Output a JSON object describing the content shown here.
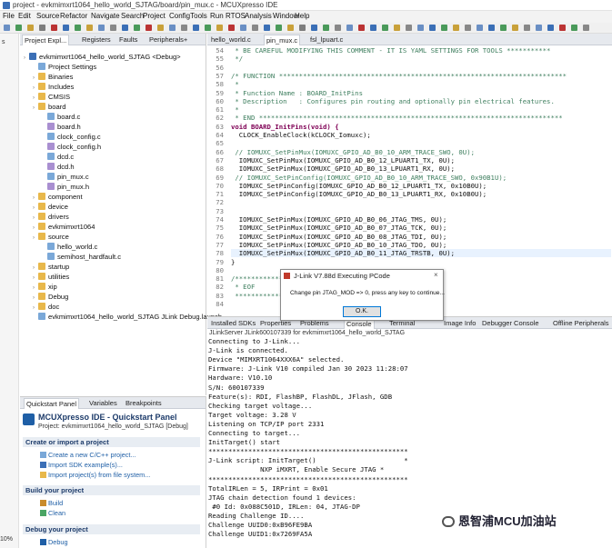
{
  "window": {
    "title": "project - evkmimxrt1064_hello_world_SJTAG/board/pin_mux.c - MCUXpresso IDE"
  },
  "menu": [
    "File",
    "Edit",
    "Source",
    "Refactor",
    "Navigate",
    "Search",
    "Project",
    "ConfigTools",
    "Run",
    "RTOS",
    "Analysis",
    "Window",
    "Help"
  ],
  "leftstrip": {
    "top": "s",
    "bottom": "10%"
  },
  "left_tabs": [
    "Project Expl...",
    "Registers",
    "Faults",
    "Peripherals+"
  ],
  "tree": [
    {
      "label": "evkmimxrt1064_hello_world_SJTAG <Debug>",
      "icon": "project-icon"
    },
    {
      "label": "Project Settings",
      "icon": "settings-icon"
    },
    {
      "label": "Binaries",
      "icon": "folder-icon"
    },
    {
      "label": "Includes",
      "icon": "folder-icon"
    },
    {
      "label": "CMSIS",
      "icon": "folder-icon"
    },
    {
      "label": "board",
      "icon": "folder-icon"
    },
    {
      "label": "board.c",
      "icon": "c-file-icon"
    },
    {
      "label": "board.h",
      "icon": "h-file-icon"
    },
    {
      "label": "clock_config.c",
      "icon": "c-file-icon"
    },
    {
      "label": "clock_config.h",
      "icon": "h-file-icon"
    },
    {
      "label": "dcd.c",
      "icon": "c-file-icon"
    },
    {
      "label": "dcd.h",
      "icon": "h-file-icon"
    },
    {
      "label": "pin_mux.c",
      "icon": "c-file-icon"
    },
    {
      "label": "pin_mux.h",
      "icon": "h-file-icon"
    },
    {
      "label": "component",
      "icon": "folder-icon"
    },
    {
      "label": "device",
      "icon": "folder-icon"
    },
    {
      "label": "drivers",
      "icon": "folder-icon"
    },
    {
      "label": "evkmimxrt1064",
      "icon": "folder-icon"
    },
    {
      "label": "source",
      "icon": "folder-icon"
    },
    {
      "label": "hello_world.c",
      "icon": "c-file-icon"
    },
    {
      "label": "semihost_hardfault.c",
      "icon": "c-file-icon"
    },
    {
      "label": "startup",
      "icon": "folder-icon"
    },
    {
      "label": "utilities",
      "icon": "folder-icon"
    },
    {
      "label": "xip",
      "icon": "folder-icon"
    },
    {
      "label": "Debug",
      "icon": "folder-icon"
    },
    {
      "label": "doc",
      "icon": "folder-icon"
    },
    {
      "label": "evkmimxrt1064_hello_world_SJTAG JLink Debug.launch",
      "icon": "launch-file-icon"
    }
  ],
  "editor_tabs": [
    "hello_world.c",
    "pin_mux.c",
    "fsl_lpuart.c"
  ],
  "code": [
    {
      "n": "54",
      "t": " * BE CAREFUL MODIFYING THIS COMMENT - IT IS YAML SETTINGS FOR TOOLS ***********",
      "c": "cm"
    },
    {
      "n": "55",
      "t": " */",
      "c": "cm"
    },
    {
      "n": "56",
      "t": "",
      "c": ""
    },
    {
      "n": "57",
      "t": "/* FUNCTION ************************************************************************",
      "c": "cm"
    },
    {
      "n": "58",
      "t": " *",
      "c": "cm"
    },
    {
      "n": "59",
      "t": " * Function Name : BOARD_InitPins",
      "c": "cm"
    },
    {
      "n": "60",
      "t": " * Description   : Configures pin routing and optionally pin electrical features.",
      "c": "cm"
    },
    {
      "n": "61",
      "t": " *",
      "c": "cm"
    },
    {
      "n": "62",
      "t": " * END ****************************************************************************",
      "c": "cm"
    },
    {
      "n": "63",
      "t": "void BOARD_InitPins(void) {",
      "c": "fnline"
    },
    {
      "n": "64",
      "t": "  CLOCK_EnableClock(kCLOCK_Iomuxc);",
      "c": "clk"
    },
    {
      "n": "65",
      "t": "",
      "c": ""
    },
    {
      "n": "66",
      "t": " // IOMUXC_SetPinMux(IOMUXC_GPIO_AD_B0_10_ARM_TRACE_SWO, 0U);",
      "c": "cm"
    },
    {
      "n": "67",
      "t": "  IOMUXC_SetPinMux(IOMUXC_GPIO_AD_B0_12_LPUART1_TX, 0U);",
      "c": ""
    },
    {
      "n": "68",
      "t": "  IOMUXC_SetPinMux(IOMUXC_GPIO_AD_B0_13_LPUART1_RX, 0U);",
      "c": ""
    },
    {
      "n": "69",
      "t": " // IOMUXC_SetPinConfig(IOMUXC_GPIO_AD_B0_10_ARM_TRACE_SWO, 0x90B1U);",
      "c": "cm"
    },
    {
      "n": "70",
      "t": "  IOMUXC_SetPinConfig(IOMUXC_GPIO_AD_B0_12_LPUART1_TX, 0x10B0U);",
      "c": ""
    },
    {
      "n": "71",
      "t": "  IOMUXC_SetPinConfig(IOMUXC_GPIO_AD_B0_13_LPUART1_RX, 0x10B0U);",
      "c": ""
    },
    {
      "n": "72",
      "t": "",
      "c": ""
    },
    {
      "n": "73",
      "t": "",
      "c": ""
    },
    {
      "n": "74",
      "t": "  IOMUXC_SetPinMux(IOMUXC_GPIO_AD_B0_06_JTAG_TMS, 0U);",
      "c": ""
    },
    {
      "n": "75",
      "t": "  IOMUXC_SetPinMux(IOMUXC_GPIO_AD_B0_07_JTAG_TCK, 0U);",
      "c": ""
    },
    {
      "n": "76",
      "t": "  IOMUXC_SetPinMux(IOMUXC_GPIO_AD_B0_08_JTAG_TDI, 0U);",
      "c": ""
    },
    {
      "n": "77",
      "t": "  IOMUXC_SetPinMux(IOMUXC_GPIO_AD_B0_10_JTAG_TDO, 0U);",
      "c": ""
    },
    {
      "n": "78",
      "t": "  IOMUXC_SetPinMux(IOMUXC_GPIO_AD_B0_11_JTAG_TRSTB, 0U);",
      "c": "hl"
    },
    {
      "n": "79",
      "t": "}",
      "c": ""
    },
    {
      "n": "80",
      "t": "",
      "c": ""
    },
    {
      "n": "81",
      "t": "/*************",
      "c": "cm"
    },
    {
      "n": "82",
      "t": " * EOF",
      "c": "cm"
    },
    {
      "n": "83",
      "t": " *************",
      "c": "cm"
    },
    {
      "n": "84",
      "t": "",
      "c": ""
    }
  ],
  "bottom_tabs": [
    "Installed SDKs",
    "Properties",
    "Problems",
    "Console",
    "Terminal",
    "Image Info",
    "Debugger Console",
    "Offline Peripherals"
  ],
  "console_title": "JLinkServer JLink600107339 for evkmimxrt1064_hello_world_SJTAG",
  "console": [
    "Connecting to J-Link...",
    "J-Link is connected.",
    "Device \"MIMXRT1064XXX6A\" selected.",
    "Firmware: J-Link V10 compiled Jan 30 2023 11:28:07",
    "Hardware: V10.10",
    "S/N: 600107339",
    "Feature(s): RDI, FlashBP, FlashDL, JFlash, GDB",
    "Checking target voltage...",
    "Target voltage: 3.28 V",
    "Listening on TCP/IP port 2331",
    "Connecting to target...",
    "InitTarget() start",
    "**************************************************",
    "J-Link script: InitTarget()                      *",
    "             NXP iMXRT, Enable Secure JTAG *",
    "**************************************************",
    "TotalIRLen = 5, IRPrint = 0x01",
    "JTAG chain detection found 1 devices:",
    " #0 Id: 0x088C501D, IRLen: 04, JTAG-DP",
    "Reading Challenge ID....",
    "Challenge UUID0:0xB96FE9BA",
    "Challenge UUID1:0x7269FA5A"
  ],
  "dialog": {
    "title": "J-Link V7.88d Executing PCode",
    "message": "Change pin JTAG_MOD => 0, press any key to continue...",
    "ok": "O.K."
  },
  "quick": {
    "tabs": [
      "Quickstart Panel",
      "Variables",
      "Breakpoints"
    ],
    "title": "MCUXpresso IDE - Quickstart Panel",
    "project": "Project: evkmimxrt1064_hello_world_SJTAG [Debug]",
    "sec1": "Create or import a project",
    "i1": "Create a new C/C++ project...",
    "i2": "Import SDK example(s)...",
    "i3": "Import project(s) from file system...",
    "sec2": "Build your project",
    "i4": "Build",
    "i5": "Clean",
    "sec3": "Debug your project",
    "i6": "Debug"
  },
  "watermark": "恩智浦MCU加油站",
  "colors": {
    "accent": "#1f5fa6",
    "comment": "#3f7f5f",
    "keyword": "#7f0055"
  }
}
